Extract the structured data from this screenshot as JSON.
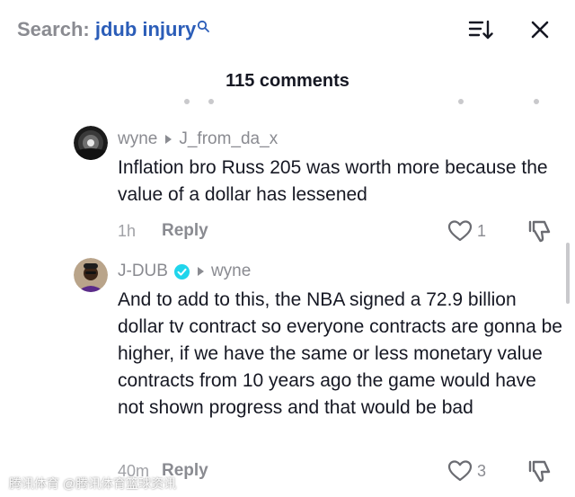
{
  "header": {
    "search_prefix": "Search:",
    "search_query": "jdub injury",
    "sort_icon": "sort-icon",
    "close_icon": "close-icon"
  },
  "comments_count": "115 comments",
  "comments": [
    {
      "author": "wyne",
      "reply_to": "J_from_da_x",
      "text": "Inflation bro Russ 205 was worth more because the value of a dollar has lessened",
      "time": "1h",
      "reply_label": "Reply",
      "likes": "1"
    },
    {
      "author": "J-DUB",
      "verified": true,
      "reply_to": "wyne",
      "text": "And to add to this, the NBA signed a 72.9 billion dollar tv contract so everyone contracts are gonna be higher, if we have the same or less monetary value contracts from 10 years ago the game would have not shown progress and that would be bad",
      "time": "40m",
      "reply_label": "Reply",
      "likes": "3"
    }
  ],
  "watermark": "腾讯体育 @腾讯体育篮球资讯",
  "colors": {
    "query": "#2b5db8",
    "verified": "#20d5ec",
    "muted": "#8a8b91"
  }
}
